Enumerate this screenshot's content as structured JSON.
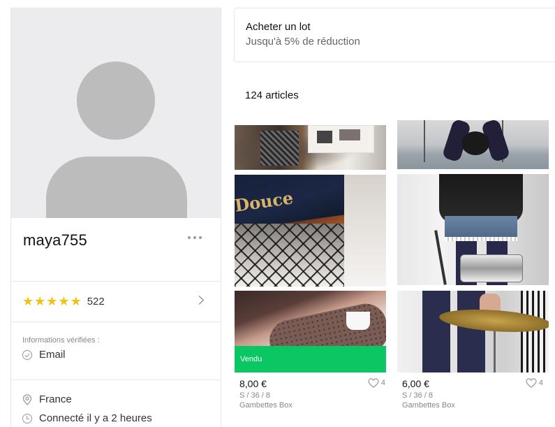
{
  "profile": {
    "username": "maya755",
    "rating_stars": 5,
    "review_count": "522",
    "verified_title": "Informations vérifiées :",
    "verified_items": [
      "Email"
    ],
    "location": "France",
    "last_seen": "Connecté il y a 2 heures"
  },
  "bundle": {
    "title": "Acheter un lot",
    "subtitle": "Jusqu'à 5% de réduction"
  },
  "catalog": {
    "count_label": "124 articles",
    "items": [
      {
        "price": "8,00 €",
        "size": "S / 36 / 8",
        "brand": "Gambettes Box",
        "likes": "4",
        "status": "Vendu"
      },
      {
        "price": "6,00 €",
        "size": "S / 36 / 8",
        "brand": "Gambettes Box",
        "likes": "4",
        "status": ""
      }
    ]
  },
  "colors": {
    "sold_green": "#0ac764",
    "star_yellow": "#f2c20f",
    "avatar_gray": "#bcbcbc"
  },
  "icons": [
    "more-dots-icon",
    "star-icon",
    "chevron-right-icon",
    "check-circle-icon",
    "location-pin-icon",
    "clock-icon",
    "heart-icon"
  ]
}
